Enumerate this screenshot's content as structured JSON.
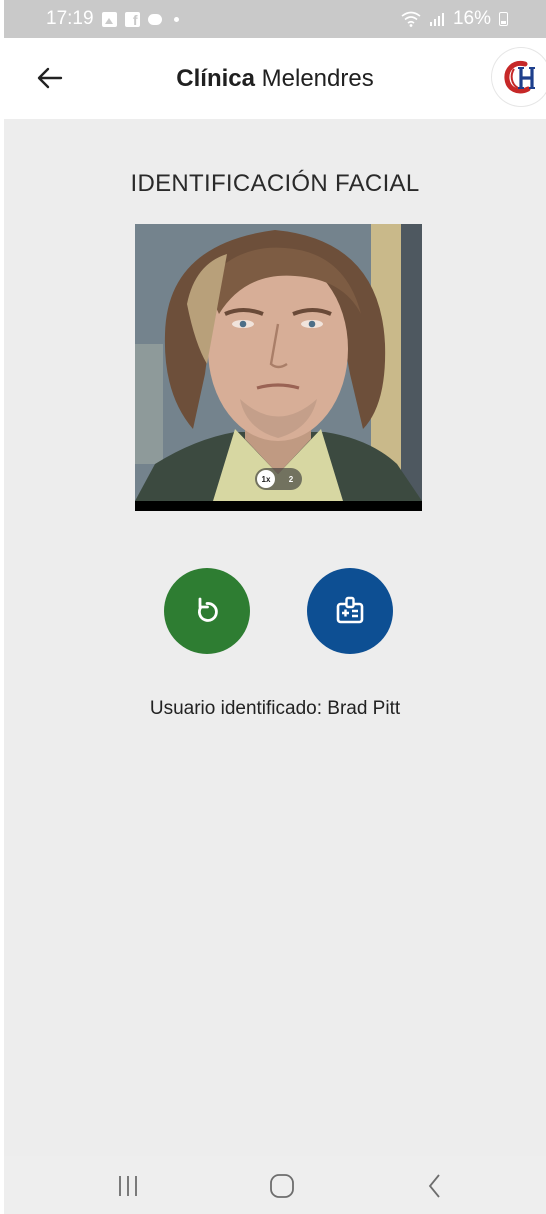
{
  "status_bar": {
    "time": "17:19",
    "battery": "16%",
    "icons": [
      "gallery-icon",
      "facebook-icon",
      "chat-bubble-icon",
      "dot-icon",
      "wifi-icon",
      "signal-icon",
      "battery-icon"
    ]
  },
  "app_bar": {
    "title_bold": "Clínica",
    "title_regular": "Melendres",
    "back_icon": "arrow-left-icon",
    "logo_text": "CH"
  },
  "main": {
    "section_title": "IDENTIFICACIÓN FACIAL",
    "zoom_options": [
      "1x",
      "2"
    ],
    "zoom_selected": "1x",
    "retry_icon": "refresh-icon",
    "identify_icon": "id-badge-icon",
    "result_text": "Usuario identificado: Brad Pitt"
  },
  "nav_bar": {
    "icons": [
      "recents-icon",
      "home-icon",
      "back-icon"
    ]
  },
  "colors": {
    "retry_button": "#2e7d32",
    "identify_button": "#0d4f93",
    "background": "#ededed",
    "status_bar": "#c9c9c9",
    "logo_red": "#c62828",
    "logo_blue": "#1e3f8c"
  }
}
